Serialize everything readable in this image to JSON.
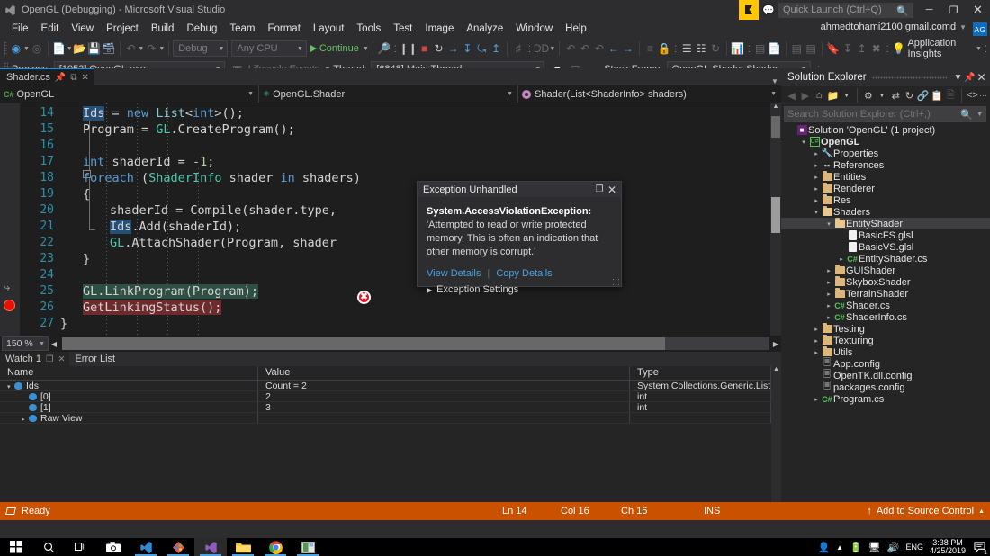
{
  "titlebar": {
    "title": "OpenGL (Debugging) - Microsoft Visual Studio",
    "quick_launch_placeholder": "Quick Launch (Ctrl+Q)",
    "minimize": "─",
    "restore": "❐",
    "close": "✕"
  },
  "menu": {
    "items": [
      "File",
      "Edit",
      "View",
      "Project",
      "Build",
      "Debug",
      "Team",
      "Format",
      "Layout",
      "Tools",
      "Test",
      "Image",
      "Analyze",
      "Window",
      "Help"
    ],
    "account": "ahmedtohami2100 gmail.comd",
    "account_initials": "AG"
  },
  "toolbar": {
    "config": "Debug",
    "platform": "Any CPU",
    "continue_label": "Continue",
    "app_insights": "Application Insights"
  },
  "debugbar": {
    "process_label": "Process:",
    "process_value": "[1052] OpenGL.exe",
    "lifecycle_label": "Lifecycle Events",
    "thread_label": "Thread:",
    "thread_value": "[6848] Main Thread",
    "stackframe_label": "Stack Frame:",
    "stackframe_value": "OpenGL.Shader.Shader"
  },
  "editor": {
    "tab_label": "Shader.cs",
    "nav_project": "OpenGL",
    "nav_class": "OpenGL.Shader",
    "nav_member": "Shader(List<ShaderInfo> shaders)",
    "zoom": "150 %",
    "lines": [
      {
        "n": "14",
        "indent": 0,
        "tokens": [
          {
            "t": "Ids",
            "c": "sel"
          },
          {
            "t": " = ",
            "c": ""
          },
          {
            "t": "new",
            "c": "kw"
          },
          {
            "t": " ",
            "c": ""
          },
          {
            "t": "List",
            "c": "cls2"
          },
          {
            "t": "<",
            "c": ""
          },
          {
            "t": "int",
            "c": "kw"
          },
          {
            "t": ">();",
            "c": ""
          }
        ]
      },
      {
        "n": "15",
        "indent": 0,
        "tokens": [
          {
            "t": "Program = ",
            "c": ""
          },
          {
            "t": "GL",
            "c": "ty"
          },
          {
            "t": ".CreateProgram();",
            "c": ""
          }
        ]
      },
      {
        "n": "16",
        "indent": 0,
        "tokens": []
      },
      {
        "n": "17",
        "indent": 0,
        "tokens": [
          {
            "t": "int",
            "c": "kw"
          },
          {
            "t": " shaderId = ",
            "c": ""
          },
          {
            "t": "-1",
            "c": "num"
          },
          {
            "t": ";",
            "c": ""
          }
        ]
      },
      {
        "n": "18",
        "indent": 0,
        "tokens": [
          {
            "t": "foreach",
            "c": "kw"
          },
          {
            "t": " (",
            "c": ""
          },
          {
            "t": "ShaderInfo",
            "c": "ty"
          },
          {
            "t": " shader ",
            "c": ""
          },
          {
            "t": "in",
            "c": "kw"
          },
          {
            "t": " shaders)",
            "c": ""
          }
        ]
      },
      {
        "n": "19",
        "indent": 0,
        "tokens": [
          {
            "t": "{",
            "c": ""
          }
        ]
      },
      {
        "n": "20",
        "indent": 1,
        "tokens": [
          {
            "t": "shaderId = Compile(shader.type,",
            "c": ""
          }
        ]
      },
      {
        "n": "21",
        "indent": 1,
        "tokens": [
          {
            "t": "Ids",
            "c": "sel"
          },
          {
            "t": ".Add(shaderId);",
            "c": ""
          }
        ]
      },
      {
        "n": "22",
        "indent": 1,
        "tokens": [
          {
            "t": "GL",
            "c": "ty"
          },
          {
            "t": ".AttachShader(Program, shader",
            "c": ""
          }
        ]
      },
      {
        "n": "23",
        "indent": 0,
        "tokens": [
          {
            "t": "}",
            "c": ""
          }
        ]
      },
      {
        "n": "24",
        "indent": 0,
        "tokens": []
      },
      {
        "n": "25",
        "indent": 0,
        "tokens": [
          {
            "t": "GL.LinkProgram(Program);",
            "c": "hl-green"
          }
        ]
      },
      {
        "n": "26",
        "indent": 0,
        "tokens": [
          {
            "t": "GetLinkingStatus();",
            "c": "hl-red"
          }
        ]
      },
      {
        "n": "27",
        "indent": -1,
        "tokens": [
          {
            "t": "}",
            "c": ""
          }
        ]
      }
    ]
  },
  "exception": {
    "title": "Exception Unhandled",
    "pin": "❐",
    "close": "✕",
    "name": "System.AccessViolationException:",
    "message": " 'Attempted to read or write protected memory. This is often an indication that other memory is corrupt.'",
    "view_details": "View Details",
    "copy_details": "Copy Details",
    "settings": "Exception Settings"
  },
  "watch": {
    "tabs": [
      {
        "label": "Watch 1",
        "active": true
      },
      {
        "label": "Error List",
        "active": false
      }
    ],
    "columns": [
      "Name",
      "Value",
      "Type"
    ],
    "rows": [
      {
        "indent": 0,
        "expander": "▾",
        "name": "Ids",
        "value": "Count = 2",
        "type": "System.Collections.Generic.List<int>"
      },
      {
        "indent": 1,
        "expander": "",
        "name": "[0]",
        "value": "2",
        "type": "int"
      },
      {
        "indent": 1,
        "expander": "",
        "name": "[1]",
        "value": "3",
        "type": "int"
      },
      {
        "indent": 1,
        "expander": "▸",
        "name": "Raw View",
        "value": "",
        "type": ""
      }
    ]
  },
  "solution_explorer": {
    "title": "Solution Explorer",
    "search_placeholder": "Search Solution Explorer (Ctrl+;)",
    "tree": [
      {
        "depth": 0,
        "tri": "",
        "icon": "sln",
        "label": "Solution 'OpenGL' (1 project)",
        "bold": false,
        "selected": false
      },
      {
        "depth": 1,
        "tri": "open",
        "icon": "prj",
        "label": "OpenGL",
        "bold": true,
        "selected": false
      },
      {
        "depth": 2,
        "tri": "closed",
        "icon": "wrench",
        "label": "Properties",
        "bold": false,
        "selected": false
      },
      {
        "depth": 2,
        "tri": "closed",
        "icon": "refs",
        "label": "References",
        "bold": false,
        "selected": false
      },
      {
        "depth": 2,
        "tri": "closed",
        "icon": "folder",
        "label": "Entities",
        "bold": false,
        "selected": false
      },
      {
        "depth": 2,
        "tri": "closed",
        "icon": "folder",
        "label": "Renderer",
        "bold": false,
        "selected": false
      },
      {
        "depth": 2,
        "tri": "closed",
        "icon": "folder",
        "label": "Res",
        "bold": false,
        "selected": false
      },
      {
        "depth": 2,
        "tri": "open",
        "icon": "folderopen",
        "label": "Shaders",
        "bold": false,
        "selected": false
      },
      {
        "depth": 3,
        "tri": "open",
        "icon": "folderopen",
        "label": "EntityShader",
        "bold": false,
        "selected": true
      },
      {
        "depth": 4,
        "tri": "",
        "icon": "file",
        "label": "BasicFS.glsl",
        "bold": false,
        "selected": false
      },
      {
        "depth": 4,
        "tri": "",
        "icon": "file",
        "label": "BasicVS.glsl",
        "bold": false,
        "selected": false
      },
      {
        "depth": 4,
        "tri": "closed",
        "icon": "cs",
        "label": "EntityShader.cs",
        "bold": false,
        "selected": false
      },
      {
        "depth": 3,
        "tri": "closed",
        "icon": "folder",
        "label": "GUIShader",
        "bold": false,
        "selected": false
      },
      {
        "depth": 3,
        "tri": "closed",
        "icon": "folder",
        "label": "SkyboxShader",
        "bold": false,
        "selected": false
      },
      {
        "depth": 3,
        "tri": "closed",
        "icon": "folder",
        "label": "TerrainShader",
        "bold": false,
        "selected": false
      },
      {
        "depth": 3,
        "tri": "closed",
        "icon": "cs",
        "label": "Shader.cs",
        "bold": false,
        "selected": false
      },
      {
        "depth": 3,
        "tri": "closed",
        "icon": "cs",
        "label": "ShaderInfo.cs",
        "bold": false,
        "selected": false
      },
      {
        "depth": 2,
        "tri": "closed",
        "icon": "folder",
        "label": "Testing",
        "bold": false,
        "selected": false
      },
      {
        "depth": 2,
        "tri": "closed",
        "icon": "folder",
        "label": "Texturing",
        "bold": false,
        "selected": false
      },
      {
        "depth": 2,
        "tri": "closed",
        "icon": "folder",
        "label": "Utils",
        "bold": false,
        "selected": false
      },
      {
        "depth": 2,
        "tri": "",
        "icon": "cfg",
        "label": "App.config",
        "bold": false,
        "selected": false
      },
      {
        "depth": 2,
        "tri": "",
        "icon": "cfg",
        "label": "OpenTK.dll.config",
        "bold": false,
        "selected": false
      },
      {
        "depth": 2,
        "tri": "",
        "icon": "cfg",
        "label": "packages.config",
        "bold": false,
        "selected": false
      },
      {
        "depth": 2,
        "tri": "closed",
        "icon": "cs",
        "label": "Program.cs",
        "bold": false,
        "selected": false
      }
    ]
  },
  "statusbar": {
    "ready": "Ready",
    "ln": "Ln 14",
    "col": "Col 16",
    "ch": "Ch 16",
    "ins": "INS",
    "source_control": "Add to Source Control",
    "accent": "#ca5100"
  },
  "taskbar": {
    "language": "ENG",
    "time": "3:38 PM",
    "date": "4/25/2019",
    "notification_count": "1"
  }
}
